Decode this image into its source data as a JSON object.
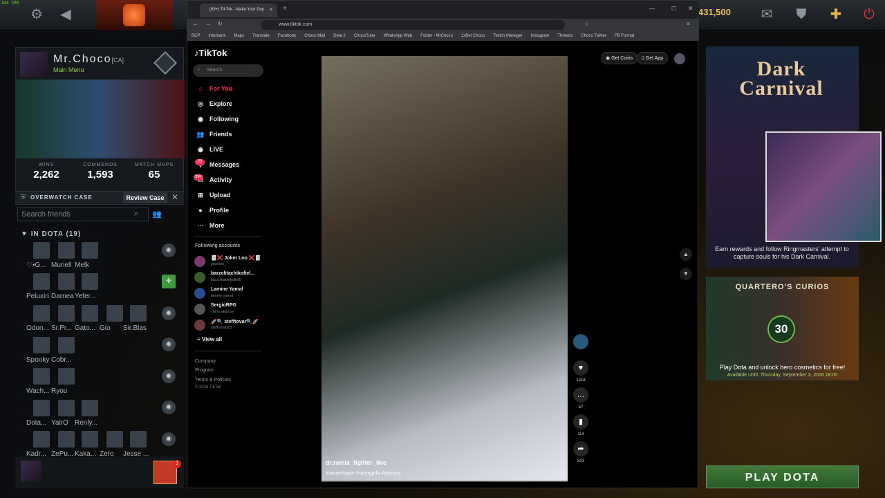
{
  "dota": {
    "fps": "144 FPS",
    "gold": "431,500",
    "profile": {
      "name": "Mr.Choco",
      "tag": "[CA]",
      "status": "Main Menu",
      "stats": [
        {
          "label": "WINS",
          "value": "2,262"
        },
        {
          "label": "COMMENDS",
          "value": "1,593"
        },
        {
          "label": "MATCH MVPS",
          "value": "65"
        }
      ]
    },
    "overwatch": {
      "title": "OVERWATCH CASE",
      "button": "Review Case"
    },
    "friends": {
      "search_placeholder": "Search friends",
      "header": "IN DOTA (19)",
      "rows": [
        [
          "♡•G...",
          "Muriell",
          "Melk"
        ],
        [
          "Peluxin",
          "Darnea",
          "Yefer..."
        ],
        [
          "Odon...",
          "Sr.Pr...",
          "Gato...",
          "Gio",
          "Sir.Blas"
        ],
        [
          "Spooky",
          "Cobr..."
        ],
        [
          "Wach...",
          "Ryou"
        ],
        [
          "Dota...",
          "YalrO",
          "Renly..."
        ],
        [
          "Kadr...",
          "ZePu...",
          "Kaka...",
          "Zero",
          "Jesse ..."
        ]
      ]
    },
    "party_badge": "3",
    "events": {
      "dark_carnival_title": "Dark Carnival",
      "dark_carnival_desc": "Earn rewards and follow Ringmasters' attempt to capture souls for his Dark Carnival.",
      "curios_title": "QUARTERO'S CURIOS",
      "curios_count": "30",
      "curios_desc": "Play Dota and unlock hero cosmetics for free!",
      "curios_avail": "Available Until:  Thursday, September 3, 2026 18:00"
    },
    "play_button": "PLAY DOTA"
  },
  "browser": {
    "tab_title": "(99+) TikTok - Make Your Day",
    "url": "www.tiktok.com",
    "bookmarks": [
      "BCP",
      "Interbank",
      "Maps",
      "Translate",
      "Facebook",
      "Choco Mail",
      "Dota 2",
      "ChocoTube",
      "WhatsApp Web",
      "Folder - MrChoco",
      "1xBet Choco",
      "Twitch Manager",
      "Instagram",
      "Threads",
      "Choco Twitter",
      "FB Format"
    ]
  },
  "tiktok": {
    "logo": "TikTok",
    "search_placeholder": "Search",
    "nav": [
      {
        "label": "For You",
        "icon": "home-icon"
      },
      {
        "label": "Explore",
        "icon": "compass-icon"
      },
      {
        "label": "Following",
        "icon": "following-icon"
      },
      {
        "label": "Friends",
        "icon": "friends-icon"
      },
      {
        "label": "LIVE",
        "icon": "live-icon"
      },
      {
        "label": "Messages",
        "icon": "messages-icon"
      },
      {
        "label": "Activity",
        "icon": "activity-icon"
      },
      {
        "label": "Upload",
        "icon": "upload-icon"
      },
      {
        "label": "Profile",
        "icon": "profile-icon"
      },
      {
        "label": "More",
        "icon": "more-icon"
      }
    ],
    "messages_badge": "23",
    "activity_badge": "99+",
    "following_header": "Following accounts",
    "accounts": [
      {
        "name": "🃏❌ Joker Loo ❌🃏",
        "handle": "jokerloo_"
      },
      {
        "name": "barzolitachikofiel...",
        "handle": "barzolitachikofiel5"
      },
      {
        "name": "Lamine Yamal",
        "handle": "lamine.yamal"
      },
      {
        "name": "SergioRPG",
        "handle": "chino.aka.toy"
      },
      {
        "name": "🚀🔍 stefftovar🔍🚀",
        "handle": "stefftovart23"
      }
    ],
    "view_all": "View all",
    "footer": [
      "Company",
      "Program",
      "Terms & Policies",
      "© 2026 TikTok"
    ],
    "get_coins": "Get Coins",
    "get_app": "Get App",
    "video": {
      "user": "dr.remix_fighter_live",
      "tags": "#sacaeltoque #santagrifa #toystory",
      "likes": "1218",
      "comments": "57",
      "saves": "114",
      "shares": "503"
    }
  }
}
